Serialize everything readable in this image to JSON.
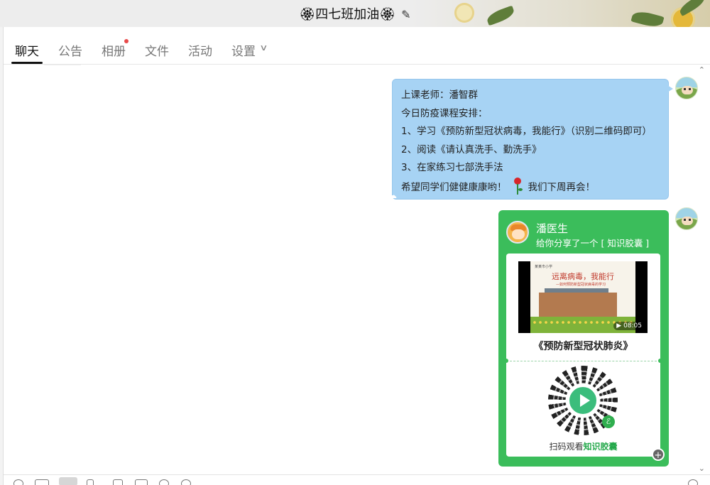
{
  "window": {
    "title": "🏵四七班加油🏵",
    "edit_icon": "edit-pencil-icon"
  },
  "tabs": [
    {
      "label": "聊天",
      "active": true
    },
    {
      "label": "公告"
    },
    {
      "label": "相册",
      "badge": "red-dot"
    },
    {
      "label": "文件"
    },
    {
      "label": "活动"
    },
    {
      "label": "设置",
      "icon": "chevron-down-icon"
    }
  ],
  "messages": {
    "text_bubble": {
      "lines": [
        "上课老师：潘智群",
        "今日防疫课程安排：",
        "1、学习《预防新型冠状病毒，我能行》（识别二维码即可）",
        "2、阅读《请认真洗手、勤洗手》",
        "3、在家练习七部洗手法"
      ],
      "last_line_before": "希望同学们健健康康哟！",
      "last_line_after": "我们下周再会！",
      "bubble_color": "#a7d3f4"
    },
    "share_card": {
      "sender": "潘医生",
      "subtitle": "给你分享了一个 [ 知识胶囊 ]",
      "video": {
        "school": "某某市小学",
        "slide_title": "远离病毒，我能行",
        "slide_subtitle": "—如何预防新型冠状病毒的学习",
        "duration": "08:05"
      },
      "title": "《预防新型冠状肺炎》",
      "scan_prefix": "扫码观看",
      "scan_highlight": "知识胶囊",
      "card_color": "#3bbd5b"
    }
  },
  "toolbar": {
    "icons": [
      "emoji-icon",
      "gif-icon",
      "scissors-icon",
      "file-icon",
      "image-icon",
      "screen-icon",
      "voice-icon",
      "more-icon",
      "history-icon"
    ]
  }
}
